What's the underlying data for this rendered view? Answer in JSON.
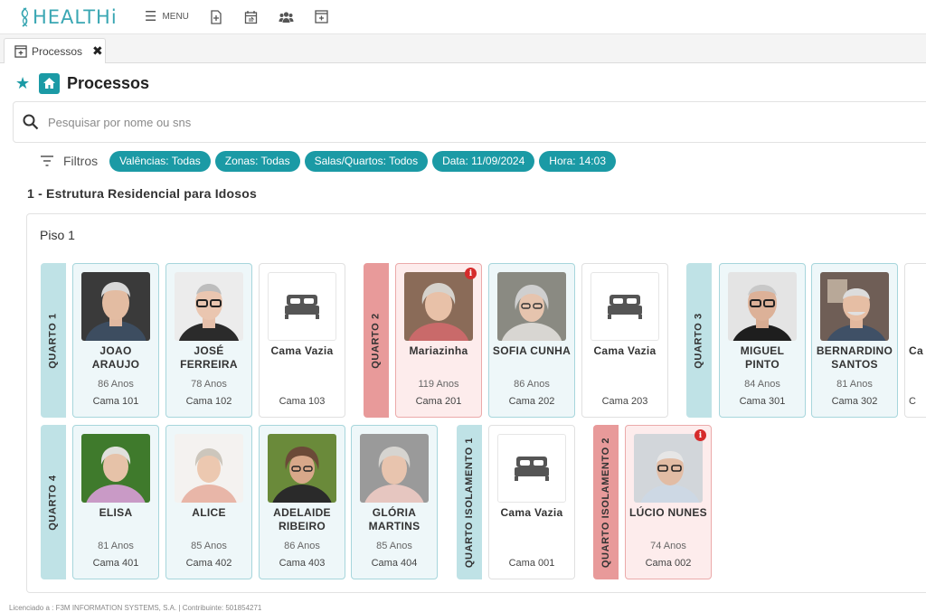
{
  "app": {
    "logo_text": "HEALTHi",
    "menu_label": "MENU"
  },
  "tabs": [
    {
      "label": "Processos"
    }
  ],
  "page": {
    "title": "Processos"
  },
  "search": {
    "placeholder": "Pesquisar por nome ou sns"
  },
  "filters": {
    "label": "Filtros",
    "chips": [
      "Valências: Todas",
      "Zonas: Todas",
      "Salas/Quartos: Todos",
      "Data: 11/09/2024",
      "Hora: 14:03"
    ]
  },
  "section": {
    "title": "1 - Estrutura Residencial para Idosos"
  },
  "floor": {
    "label": "Piso 1"
  },
  "rooms": {
    "r1": "QUARTO 1",
    "r2": "QUARTO 2",
    "r3": "QUARTO 3",
    "r4": "QUARTO 4",
    "iso1": "QUARTO ISOLAMENTO 1",
    "iso2": "QUARTO ISOLAMENTO 2"
  },
  "beds": {
    "b101": {
      "name1": "JOAO",
      "name2": "ARAUJO",
      "age": "86 Anos",
      "bed": "Cama 101"
    },
    "b102": {
      "name1": "JOSÉ",
      "name2": "FERREIRA",
      "age": "78 Anos",
      "bed": "Cama 102"
    },
    "b103": {
      "name1": "Cama Vazia",
      "name2": "",
      "age": "",
      "bed": "Cama 103"
    },
    "b201": {
      "name1": "Mariazinha",
      "name2": "",
      "age": "119 Anos",
      "bed": "Cama 201"
    },
    "b202": {
      "name1": "SOFIA CUNHA",
      "name2": "",
      "age": "86 Anos",
      "bed": "Cama 202"
    },
    "b203": {
      "name1": "Cama Vazia",
      "name2": "",
      "age": "",
      "bed": "Cama 203"
    },
    "b301": {
      "name1": "MIGUEL",
      "name2": "PINTO",
      "age": "84 Anos",
      "bed": "Cama 301"
    },
    "b302": {
      "name1": "BERNARDINO",
      "name2": "SANTOS",
      "age": "81 Anos",
      "bed": "Cama 302"
    },
    "b303": {
      "name1": "Ca",
      "name2": "",
      "age": "",
      "bed": "C"
    },
    "b401": {
      "name1": "ELISA",
      "name2": "",
      "age": "81 Anos",
      "bed": "Cama 401"
    },
    "b402": {
      "name1": "ALICE",
      "name2": "",
      "age": "85 Anos",
      "bed": "Cama 402"
    },
    "b403": {
      "name1": "ADELAIDE",
      "name2": "RIBEIRO",
      "age": "86 Anos",
      "bed": "Cama 403"
    },
    "b404": {
      "name1": "GLÓRIA",
      "name2": "MARTINS",
      "age": "85 Anos",
      "bed": "Cama 404"
    },
    "b001": {
      "name1": "Cama Vazia",
      "name2": "",
      "age": "",
      "bed": "Cama 001"
    },
    "b002": {
      "name1": "LÚCIO NUNES",
      "name2": "",
      "age": "74 Anos",
      "bed": "Cama 002"
    }
  },
  "alert_glyph": "i",
  "footer": {
    "text": "Licenciado a : F3M INFORMATION SYSTEMS, S.A. | Contribuinte: 501854271"
  },
  "colors": {
    "accent": "#1b9aa5",
    "room_teal": "#bfe2e6",
    "room_red": "#e89a9a",
    "alert": "#d62b2b"
  }
}
